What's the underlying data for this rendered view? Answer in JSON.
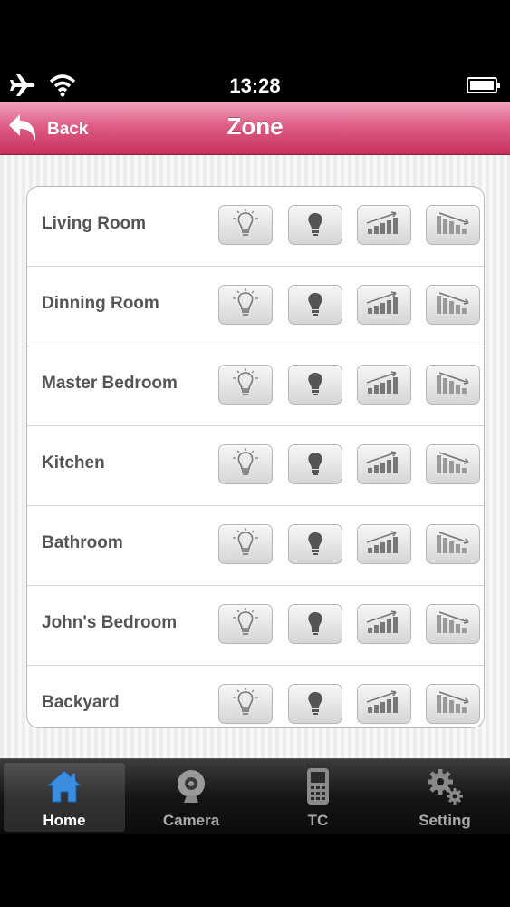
{
  "status_bar": {
    "time": "13:28",
    "icons": [
      "airplane-icon",
      "wifi-icon",
      "battery-icon"
    ]
  },
  "nav": {
    "back_label": "Back",
    "title": "Zone"
  },
  "zones": [
    {
      "name": "Living Room"
    },
    {
      "name": "Dinning Room"
    },
    {
      "name": "Master Bedroom"
    },
    {
      "name": "Kitchen"
    },
    {
      "name": "Bathroom"
    },
    {
      "name": "John's Bedroom"
    },
    {
      "name": "Backyard"
    }
  ],
  "zone_controls": [
    "light-on-icon",
    "light-off-icon",
    "dim-up-icon",
    "dim-down-icon"
  ],
  "tabs": [
    {
      "label": "Home",
      "icon": "home-icon",
      "active": true
    },
    {
      "label": "Camera",
      "icon": "camera-icon",
      "active": false
    },
    {
      "label": "TC",
      "icon": "phone-icon",
      "active": false
    },
    {
      "label": "Setting",
      "icon": "gear-icon",
      "active": false
    }
  ],
  "colors": {
    "nav_bar": "#d94f7c",
    "tab_active": "#3b8de0",
    "label_text": "#555555"
  }
}
